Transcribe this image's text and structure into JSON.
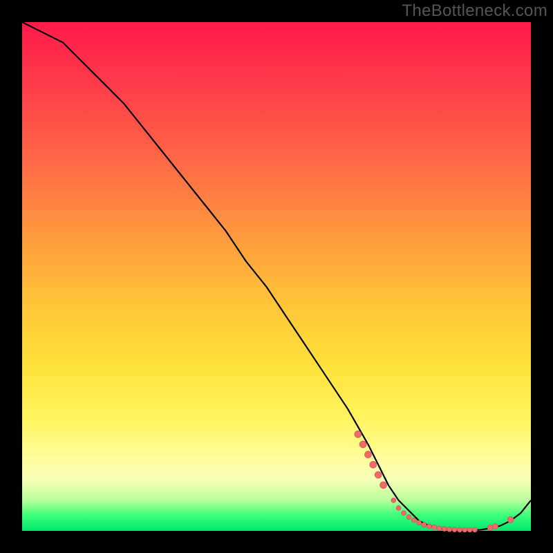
{
  "watermark": "TheBottleneck.com",
  "colors": {
    "curve_stroke": "#000000",
    "marker_fill": "#f06a6a",
    "marker_stroke": "#cc4e4e"
  },
  "chart_data": {
    "type": "line",
    "title": "",
    "xlabel": "",
    "ylabel": "",
    "xlim": [
      0,
      100
    ],
    "ylim": [
      0,
      100
    ],
    "grid": false,
    "legend": false,
    "curve": {
      "x": [
        0,
        4,
        8,
        12,
        16,
        20,
        24,
        28,
        32,
        36,
        40,
        44,
        48,
        52,
        56,
        60,
        64,
        68,
        70,
        72,
        74,
        76,
        78,
        80,
        82,
        84,
        86,
        88,
        90,
        92,
        94,
        96,
        98,
        100
      ],
      "y": [
        100,
        98,
        96,
        92,
        88,
        84,
        79,
        74,
        69,
        64,
        59,
        53,
        48,
        42,
        36,
        30,
        24,
        17,
        13,
        9,
        6,
        4,
        2,
        1,
        0.5,
        0.2,
        0.1,
        0.1,
        0.2,
        0.5,
        1,
        2,
        3.5,
        6
      ]
    },
    "markers": [
      {
        "x": 66,
        "y": 19,
        "r": 5
      },
      {
        "x": 67,
        "y": 17,
        "r": 5
      },
      {
        "x": 68,
        "y": 15,
        "r": 5
      },
      {
        "x": 69,
        "y": 13,
        "r": 5
      },
      {
        "x": 70,
        "y": 11,
        "r": 5
      },
      {
        "x": 71,
        "y": 9,
        "r": 5
      },
      {
        "x": 73,
        "y": 6,
        "r": 3.5
      },
      {
        "x": 74,
        "y": 4.5,
        "r": 3.5
      },
      {
        "x": 75,
        "y": 3.5,
        "r": 3.5
      },
      {
        "x": 76,
        "y": 2.7,
        "r": 3.5
      },
      {
        "x": 77,
        "y": 2.1,
        "r": 3.5
      },
      {
        "x": 78,
        "y": 1.6,
        "r": 3.5
      },
      {
        "x": 79,
        "y": 1.2,
        "r": 3.5
      },
      {
        "x": 80,
        "y": 0.9,
        "r": 3.5
      },
      {
        "x": 81,
        "y": 0.7,
        "r": 3.5
      },
      {
        "x": 82,
        "y": 0.5,
        "r": 3.5
      },
      {
        "x": 83,
        "y": 0.4,
        "r": 3.5
      },
      {
        "x": 84,
        "y": 0.3,
        "r": 3.5
      },
      {
        "x": 85,
        "y": 0.25,
        "r": 3.5
      },
      {
        "x": 86,
        "y": 0.2,
        "r": 3.5
      },
      {
        "x": 87,
        "y": 0.2,
        "r": 3.5
      },
      {
        "x": 88,
        "y": 0.2,
        "r": 3.5
      },
      {
        "x": 89,
        "y": 0.2,
        "r": 3.5
      },
      {
        "x": 92,
        "y": 0.6,
        "r": 4
      },
      {
        "x": 93,
        "y": 0.9,
        "r": 4
      },
      {
        "x": 96,
        "y": 2.2,
        "r": 4.5
      }
    ]
  }
}
